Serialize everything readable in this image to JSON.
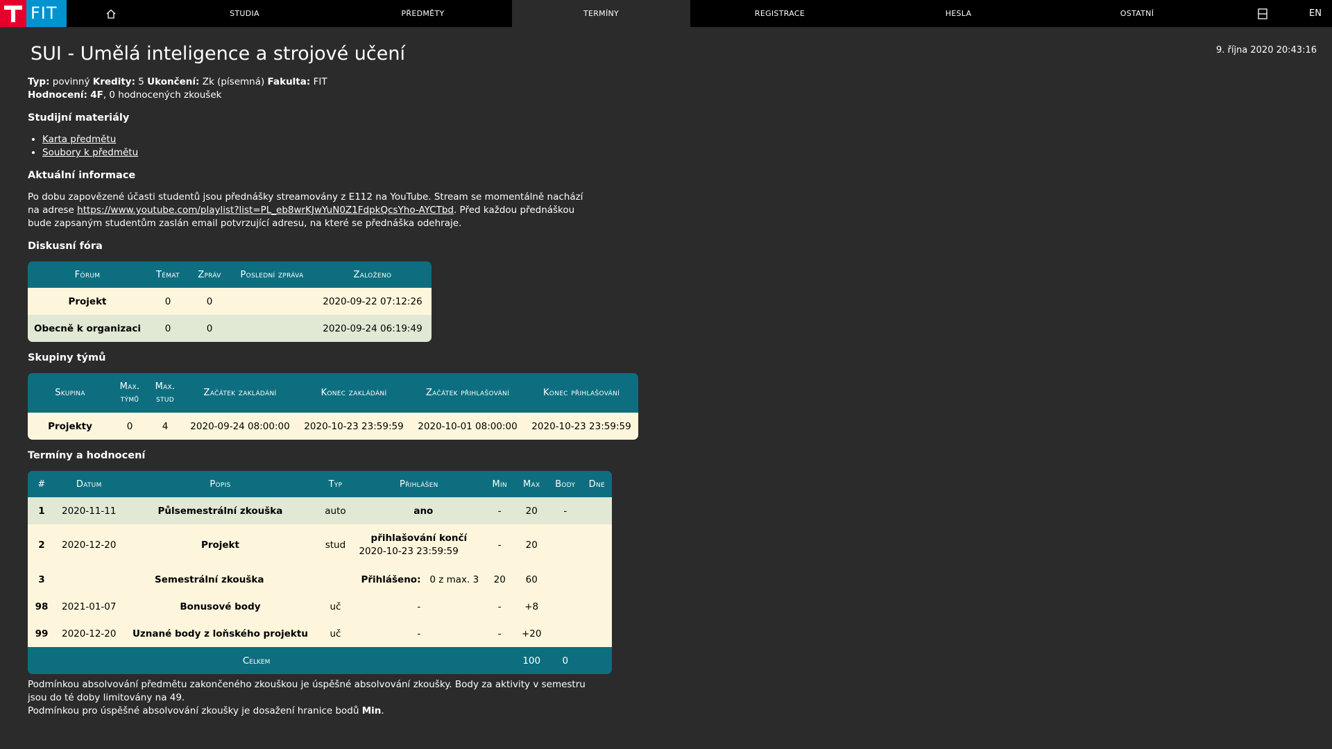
{
  "nav": {
    "logo_text": "FIT",
    "items": [
      "Studia",
      "Předměty",
      "Termíny",
      "Registrace",
      "Hesla",
      "Ostatní"
    ],
    "active": "Termíny",
    "lang": "EN"
  },
  "datetime": "9. října 2020 20:43:16",
  "page": {
    "title": "SUI - Umělá inteligence a strojové učení",
    "typ_label": "Typ:",
    "typ_value": "povinný",
    "kredity_label": "Kredity:",
    "kredity_value": "5",
    "ukonceni_label": "Ukončení:",
    "ukonceni_value": "Zk (písemná)",
    "fakulta_label": "Fakulta:",
    "fakulta_value": "FIT",
    "hodnoceni_label": "Hodnocení:",
    "hodnoceni_grade": "4F",
    "hodnoceni_rest": ", 0 hodnocených zkoušek"
  },
  "materials": {
    "heading": "Studijní materiály",
    "links": [
      "Karta předmětu",
      "Soubory k předmětu"
    ]
  },
  "news": {
    "heading": "Aktuální informace",
    "text_before": "Po dobu zapovězené účasti studentů jsou přednášky streamovány z E112 na YouTube. Stream se momentálně nachází na adrese ",
    "link": "https://www.youtube.com/playlist?list=PL_eb8wrKJwYuN0Z1FdpkQcsYho-AYCTbd",
    "text_after": ". Před každou přednáškou bude zapsaným studentům zaslán email potvrzující adresu, na které se přednáška odehraje."
  },
  "forums": {
    "heading": "Diskusní fóra",
    "columns": [
      "Fórum",
      "Témat",
      "Zpráv",
      "Poslední zpráva",
      "Založeno"
    ],
    "rows": [
      [
        "Projekt",
        "0",
        "0",
        "",
        "2020-09-22 07:12:26"
      ],
      [
        "Obecně k organizaci",
        "0",
        "0",
        "",
        "2020-09-24 06:19:49"
      ]
    ]
  },
  "teams": {
    "heading": "Skupiny týmů",
    "columns": [
      "Skupina",
      "Max. týmů",
      "Max. stud",
      "Začátek zakládání",
      "Konec zakládání",
      "Začátek přihlašování",
      "Konec přihlašování"
    ],
    "rows": [
      [
        "Projekty",
        "0",
        "4",
        "2020-09-24 08:00:00",
        "2020-10-23 23:59:59",
        "2020-10-01 08:00:00",
        "2020-10-23 23:59:59"
      ]
    ]
  },
  "terms": {
    "heading": "Termíny a hodnocení",
    "columns": [
      "#",
      "Datum",
      "Popis",
      "Typ",
      "Přihlášen",
      "Min",
      "Max",
      "Body",
      "Dne"
    ],
    "rows": [
      {
        "n": "1",
        "datum": "2020-11-11",
        "popis": "Půlsemestrální zkouška",
        "typ": "auto",
        "prihlasen": "ano",
        "min": "-",
        "max": "20",
        "body": "-",
        "dne": ""
      },
      {
        "n": "2",
        "datum": "2020-12-20",
        "popis": "Projekt",
        "typ": "stud",
        "prihlasen_title": "přihlašování končí",
        "prihlasen_date": "2020-10-23 23:59:59",
        "min": "-",
        "max": "20",
        "body": "",
        "dne": ""
      },
      {
        "n": "3",
        "popis": "Semestrální zkouška",
        "prihlaseno_label": "Přihlášeno:",
        "prihlaseno_value": "0 z max. 3",
        "min": "20",
        "max": "60",
        "body": "",
        "dne": ""
      },
      {
        "n": "98",
        "datum": "2021-01-07",
        "popis": "Bonusové body",
        "typ": "uč",
        "prihlasen": "-",
        "min": "-",
        "max": "+8",
        "body": "",
        "dne": ""
      },
      {
        "n": "99",
        "datum": "2020-12-20",
        "popis": "Uznané body z loňského projektu",
        "typ": "uč",
        "prihlasen": "-",
        "min": "-",
        "max": "+20",
        "body": "",
        "dne": ""
      }
    ],
    "total_label": "Celkem",
    "total_max": "100",
    "total_body": "0"
  },
  "footnote": {
    "line1": "Podmínkou absolvování předmětu zakončeného zkouškou je úspěšné absolvování zkoušky. Body za aktivity v semestru jsou do té doby limitovány na 49.",
    "line2_before": "Podmínkou pro úspěšné absolvování zkoušky je dosažení hranice bodů ",
    "line2_bold": "Min",
    "line2_after": "."
  }
}
